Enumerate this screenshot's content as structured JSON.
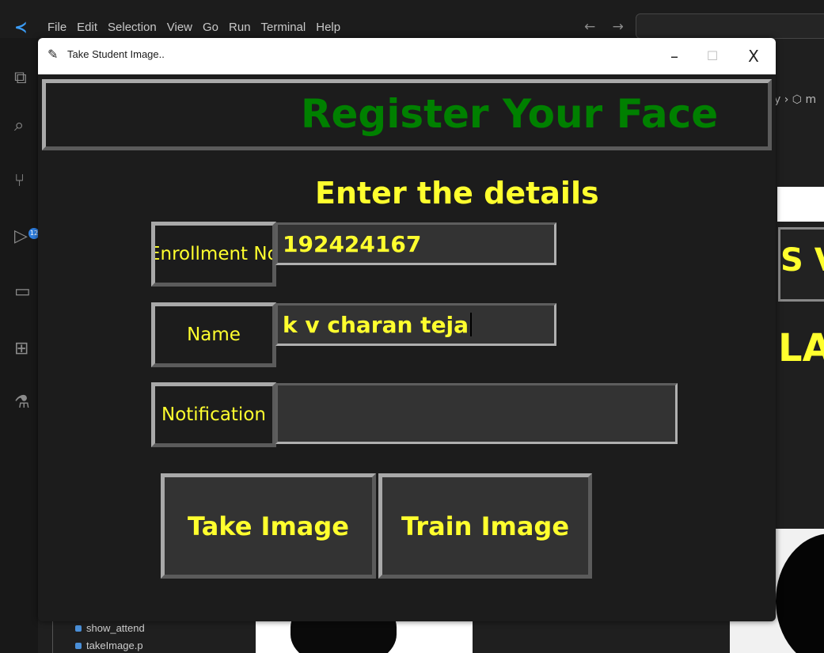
{
  "vscode": {
    "menu": [
      "File",
      "Edit",
      "Selection",
      "View",
      "Go",
      "Run",
      "Terminal",
      "Help"
    ],
    "nav_arrows": "← →",
    "breadcrumb_fragment": "y › ⬡ m",
    "source_control_badge": "12",
    "files": [
      "show_attend",
      "takeImage.p"
    ],
    "bg_text_1": "S V",
    "bg_text_2": "LA"
  },
  "window": {
    "title": "Take Student Image..",
    "minimize": "–",
    "maximize": "☐",
    "close": "X"
  },
  "form": {
    "heading": "Register Your Face",
    "subheading": "Enter the details",
    "enrollment_label": "Enrollment No",
    "enrollment_value": "192424167",
    "name_label": "Name",
    "name_value": "k v charan teja",
    "notification_label": "Notification",
    "notification_value": "",
    "take_image_button": "Take Image",
    "train_image_button": "Train Image"
  },
  "colors": {
    "label_text": "#ffff2e",
    "heading": "#008000",
    "window_bg": "#1c1c1c",
    "input_bg": "#333333"
  }
}
